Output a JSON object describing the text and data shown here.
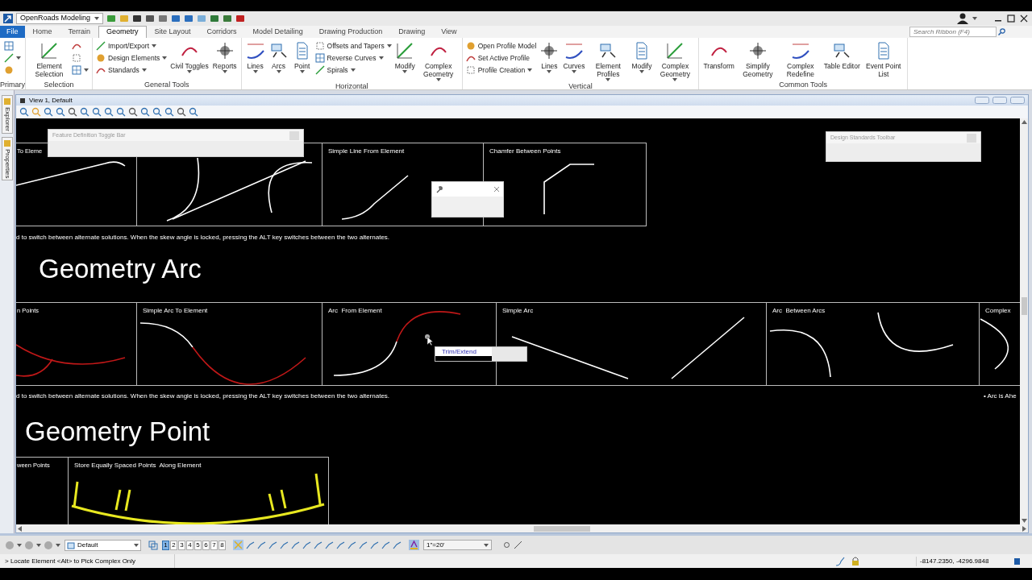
{
  "title_bar": {
    "workflow": "OpenRoads Modeling"
  },
  "ribbon_tabs": [
    {
      "label": "File",
      "kind": "file"
    },
    {
      "label": "Home",
      "kind": "tab",
      "selected": false
    },
    {
      "label": "Terrain",
      "kind": "tab",
      "selected": false
    },
    {
      "label": "Geometry",
      "kind": "tab",
      "selected": true
    },
    {
      "label": "Site Layout",
      "kind": "tab",
      "selected": false
    },
    {
      "label": "Corridors",
      "kind": "tab",
      "selected": false
    },
    {
      "label": "Model Detailing",
      "kind": "tab",
      "selected": false
    },
    {
      "label": "Drawing Production",
      "kind": "tab",
      "selected": false
    },
    {
      "label": "Drawing",
      "kind": "tab",
      "selected": false
    },
    {
      "label": "View",
      "kind": "tab",
      "selected": false
    }
  ],
  "search_ribbon": {
    "placeholder": "Search Ribbon (F4)"
  },
  "ribbon_groups": [
    {
      "name": "Primary",
      "tools": [
        {
          "kind": "icon",
          "dropdown": false
        },
        {
          "kind": "icon",
          "dropdown": true
        },
        {
          "kind": "icon",
          "dropdown": false
        }
      ]
    },
    {
      "name": "Selection",
      "tools": [
        {
          "kind": "large",
          "label": "Element Selection",
          "dropdown": false
        },
        {
          "kind": "icon",
          "dropdown": false
        },
        {
          "kind": "icon",
          "dropdown": false
        },
        {
          "kind": "icon",
          "dropdown": true
        }
      ]
    },
    {
      "name": "General Tools",
      "tools": [
        {
          "kind": "small",
          "label": "Import/Export",
          "dropdown": true
        },
        {
          "kind": "small",
          "label": "Design Elements",
          "dropdown": true
        },
        {
          "kind": "small",
          "label": "Standards",
          "dropdown": true
        },
        {
          "kind": "large",
          "label": "Civil Toggles",
          "dropdown": true
        },
        {
          "kind": "large",
          "label": "Reports",
          "dropdown": true
        }
      ]
    },
    {
      "name": "Horizontal",
      "tools": [
        {
          "kind": "large",
          "label": "Lines",
          "dropdown": true
        },
        {
          "kind": "large",
          "label": "Arcs",
          "dropdown": true
        },
        {
          "kind": "large",
          "label": "Point",
          "dropdown": true
        },
        {
          "kind": "small",
          "label": "Offsets and Tapers",
          "dropdown": true
        },
        {
          "kind": "small",
          "label": "Reverse Curves",
          "dropdown": true
        },
        {
          "kind": "small",
          "label": "Spirals",
          "dropdown": true
        },
        {
          "kind": "large",
          "label": "Modify",
          "dropdown": true
        },
        {
          "kind": "large",
          "label": "Complex Geometry",
          "dropdown": true
        }
      ]
    },
    {
      "name": "Vertical",
      "tools": [
        {
          "kind": "small",
          "label": "Open Profile Model",
          "dropdown": false
        },
        {
          "kind": "small",
          "label": "Set Active Profile",
          "dropdown": false
        },
        {
          "kind": "small",
          "label": "Profile Creation",
          "dropdown": true
        },
        {
          "kind": "large",
          "label": "Lines",
          "dropdown": true
        },
        {
          "kind": "large",
          "label": "Curves",
          "dropdown": true
        },
        {
          "kind": "large",
          "label": "Element Profiles",
          "dropdown": true
        },
        {
          "kind": "large",
          "label": "Modify",
          "dropdown": true
        },
        {
          "kind": "large",
          "label": "Complex Geometry",
          "dropdown": true
        }
      ]
    },
    {
      "name": "Common Tools",
      "tools": [
        {
          "kind": "large",
          "label": "Transform",
          "dropdown": false
        },
        {
          "kind": "large",
          "label": "Simplify Geometry",
          "dropdown": false
        },
        {
          "kind": "large",
          "label": "Complex Redefine",
          "dropdown": false
        },
        {
          "kind": "large",
          "label": "Table Editor",
          "dropdown": false
        },
        {
          "kind": "large",
          "label": "Event Point List",
          "dropdown": false
        }
      ]
    }
  ],
  "side_panel": {
    "tabs": [
      "Explorer",
      "Properties"
    ]
  },
  "view": {
    "title": "View 1, Default"
  },
  "canvas": {
    "headings": [
      "Geometry Arc",
      "Geometry Point"
    ],
    "diagram_rows": [
      {
        "cells": [
          {
            "label": "To Eleme"
          },
          {},
          {
            "label": "Simple Line From Element"
          },
          {
            "label": "Chamfer Between Points"
          }
        ]
      },
      {
        "cells": [
          {
            "label": "n Points"
          },
          {
            "label": "Simple Arc To Element"
          },
          {
            "label": "Arc  From Element"
          },
          {
            "label": "Simple Arc"
          },
          {
            "label": "Arc  Between Arcs"
          },
          {
            "label": "Complex"
          }
        ]
      },
      {
        "cells": [
          {
            "label": "ween Points"
          },
          {
            "label": "Store Equally Spaced Points  Along Element"
          }
        ]
      }
    ],
    "notes": [
      "d to switch between alternate solutions. When the skew angle is locked, pressing the ALT key switches between the two alternates.",
      "d to switch between alternate solutions. When the skew angle is locked, pressing the ALT key switches between the two alternates.",
      "• Arc is Ahe"
    ],
    "tooltip": "Trim/Extend"
  },
  "floating_toolbars": [
    {
      "title": "Feature Definition Toggle Bar"
    },
    {
      "title": "Design Standards Toolbar"
    }
  ],
  "view_controls": {
    "display_style": "Default",
    "view_numbers": [
      {
        "label": "1",
        "selected": true
      },
      {
        "label": "2",
        "selected": false
      },
      {
        "label": "3",
        "selected": false
      },
      {
        "label": "4",
        "selected": false
      },
      {
        "label": "5",
        "selected": false
      },
      {
        "label": "6",
        "selected": false
      },
      {
        "label": "7",
        "selected": false
      },
      {
        "label": "8",
        "selected": false
      }
    ],
    "scale": "1\"=20'"
  },
  "status_bar": {
    "prompt": "> Locate Element <Alt> to Pick Complex Only",
    "coordinates": "-8147.2350, -4296.9848"
  }
}
